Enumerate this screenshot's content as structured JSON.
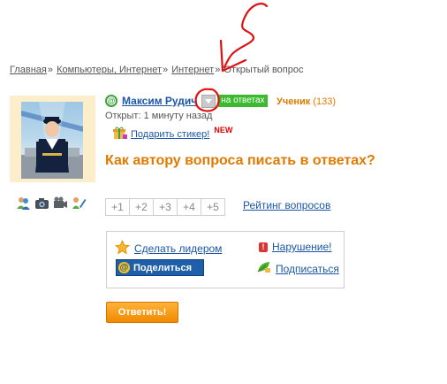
{
  "breadcrumb": {
    "items": [
      "Главная",
      "Компьютеры, Интернет",
      "Интернет"
    ],
    "current": "Открытый вопрос",
    "separator": "»"
  },
  "question": {
    "author_name": "Максим Рудич",
    "status_badge": "на ответах",
    "rank_name": "Ученик",
    "rank_points": "(133)",
    "opened_text": "Открыт: 1 минуту назад",
    "sticker_label": "Подарить стикер!",
    "new_badge": "NEW",
    "title": "Как автору вопроса писать в ответах?"
  },
  "rating": {
    "buttons": [
      "+1",
      "+2",
      "+3",
      "+4",
      "+5"
    ],
    "link_label": "Рейтинг вопросов"
  },
  "actions": {
    "make_leader": "Сделать лидером",
    "violation": "Нарушение!",
    "share": "Поделиться",
    "subscribe": "Подписаться"
  },
  "answer_button": "Ответить!",
  "icons": {
    "profile": [
      "friends-icon",
      "camera-icon",
      "video-icon",
      "edit-icon"
    ],
    "user_link": "at-icon",
    "dropdown": "chevron-down-icon",
    "sticker": "gift-icon",
    "leader": "star-icon",
    "violation": "warning-icon",
    "subscribe": "subscribe-icon"
  },
  "colors": {
    "accent_orange": "#e07a00",
    "link_blue": "#1c56a8",
    "badge_green": "#3cba2f",
    "annotation_red": "#e01010"
  }
}
